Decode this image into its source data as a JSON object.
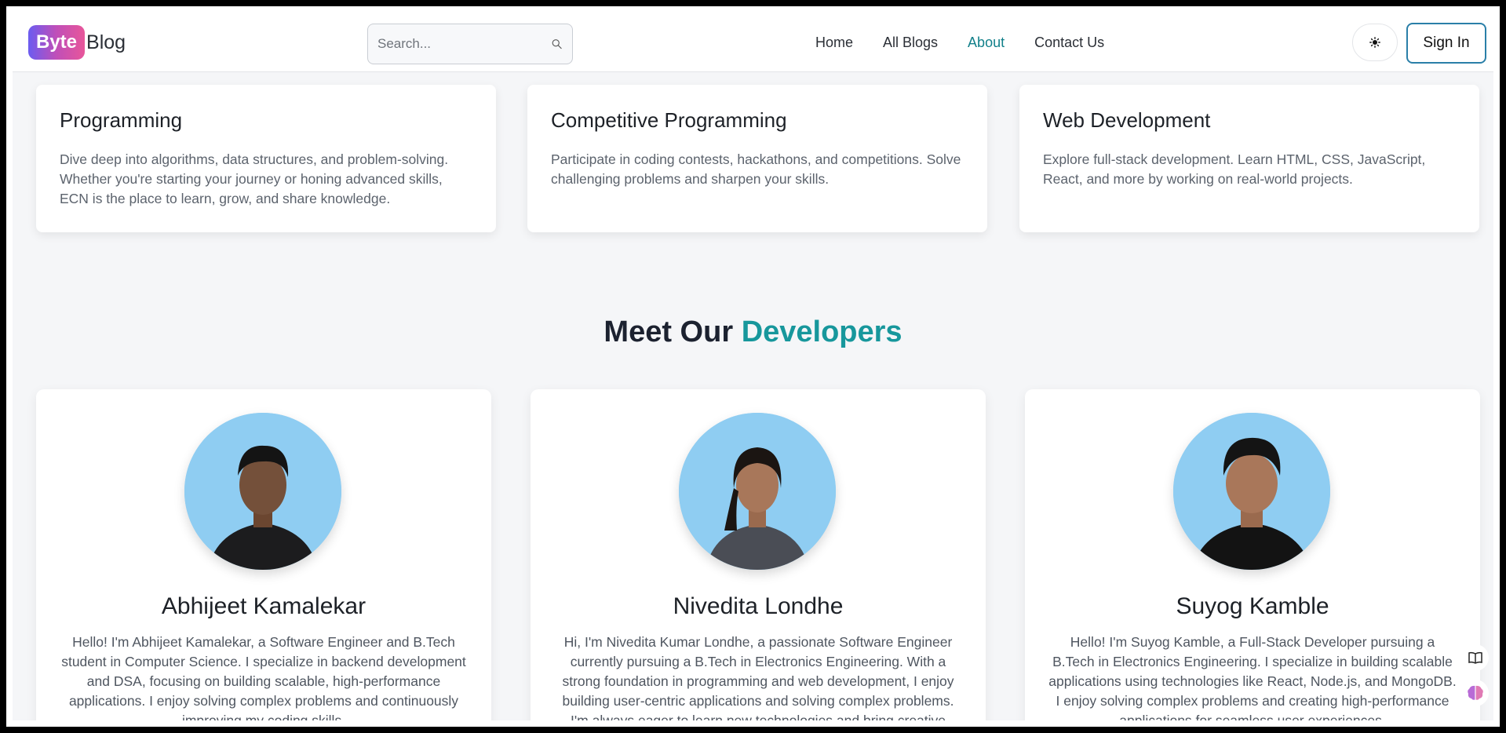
{
  "header": {
    "logo_badge": "Byte",
    "logo_text": "Blog",
    "search_placeholder": "Search...",
    "nav": [
      {
        "label": "Home",
        "active": false
      },
      {
        "label": "All Blogs",
        "active": false
      },
      {
        "label": "About",
        "active": true
      },
      {
        "label": "Contact Us",
        "active": false
      }
    ],
    "theme_icon": "sun-icon",
    "signin_label": "Sign In"
  },
  "categories": [
    {
      "title": "Programming",
      "description": "Dive deep into algorithms, data structures, and problem-solving. Whether you're starting your journey or honing advanced skills, ECN is the place to learn, grow, and share knowledge."
    },
    {
      "title": "Competitive Programming",
      "description": "Participate in coding contests, hackathons, and competitions. Solve challenging problems and sharpen your skills."
    },
    {
      "title": "Web Development",
      "description": "Explore full-stack development. Learn HTML, CSS, JavaScript, React, and more by working on real-world projects."
    }
  ],
  "developers_section": {
    "title_part1": "Meet Our",
    "title_part2": "Developers"
  },
  "developers": [
    {
      "name": "Abhijeet Kamalekar",
      "bio": "Hello! I'm Abhijeet Kamalekar, a Software Engineer and B.Tech student in Computer Science. I specialize in backend development and DSA, focusing on building scalable, high-performance applications. I enjoy solving complex problems and continuously improving my coding skills."
    },
    {
      "name": "Nivedita Londhe",
      "bio": "Hi, I'm Nivedita Kumar Londhe, a passionate Software Engineer currently pursuing a B.Tech in Electronics Engineering. With a strong foundation in programming and web development, I enjoy building user-centric applications and solving complex problems. I'm always eager to learn new technologies and bring creative"
    },
    {
      "name": "Suyog Kamble",
      "bio": "Hello! I'm Suyog Kamble, a Full-Stack Developer pursuing a B.Tech in Electronics Engineering. I specialize in building scalable applications using technologies like React, Node.js, and MongoDB. I enjoy solving complex problems and creating high-performance applications for seamless user experiences."
    }
  ],
  "floating": [
    {
      "icon": "book-icon"
    },
    {
      "icon": "brain-icon"
    }
  ],
  "colors": {
    "accent": "#17979c",
    "nav_active": "#12808a",
    "avatar_bg": "#8fcdf2"
  }
}
